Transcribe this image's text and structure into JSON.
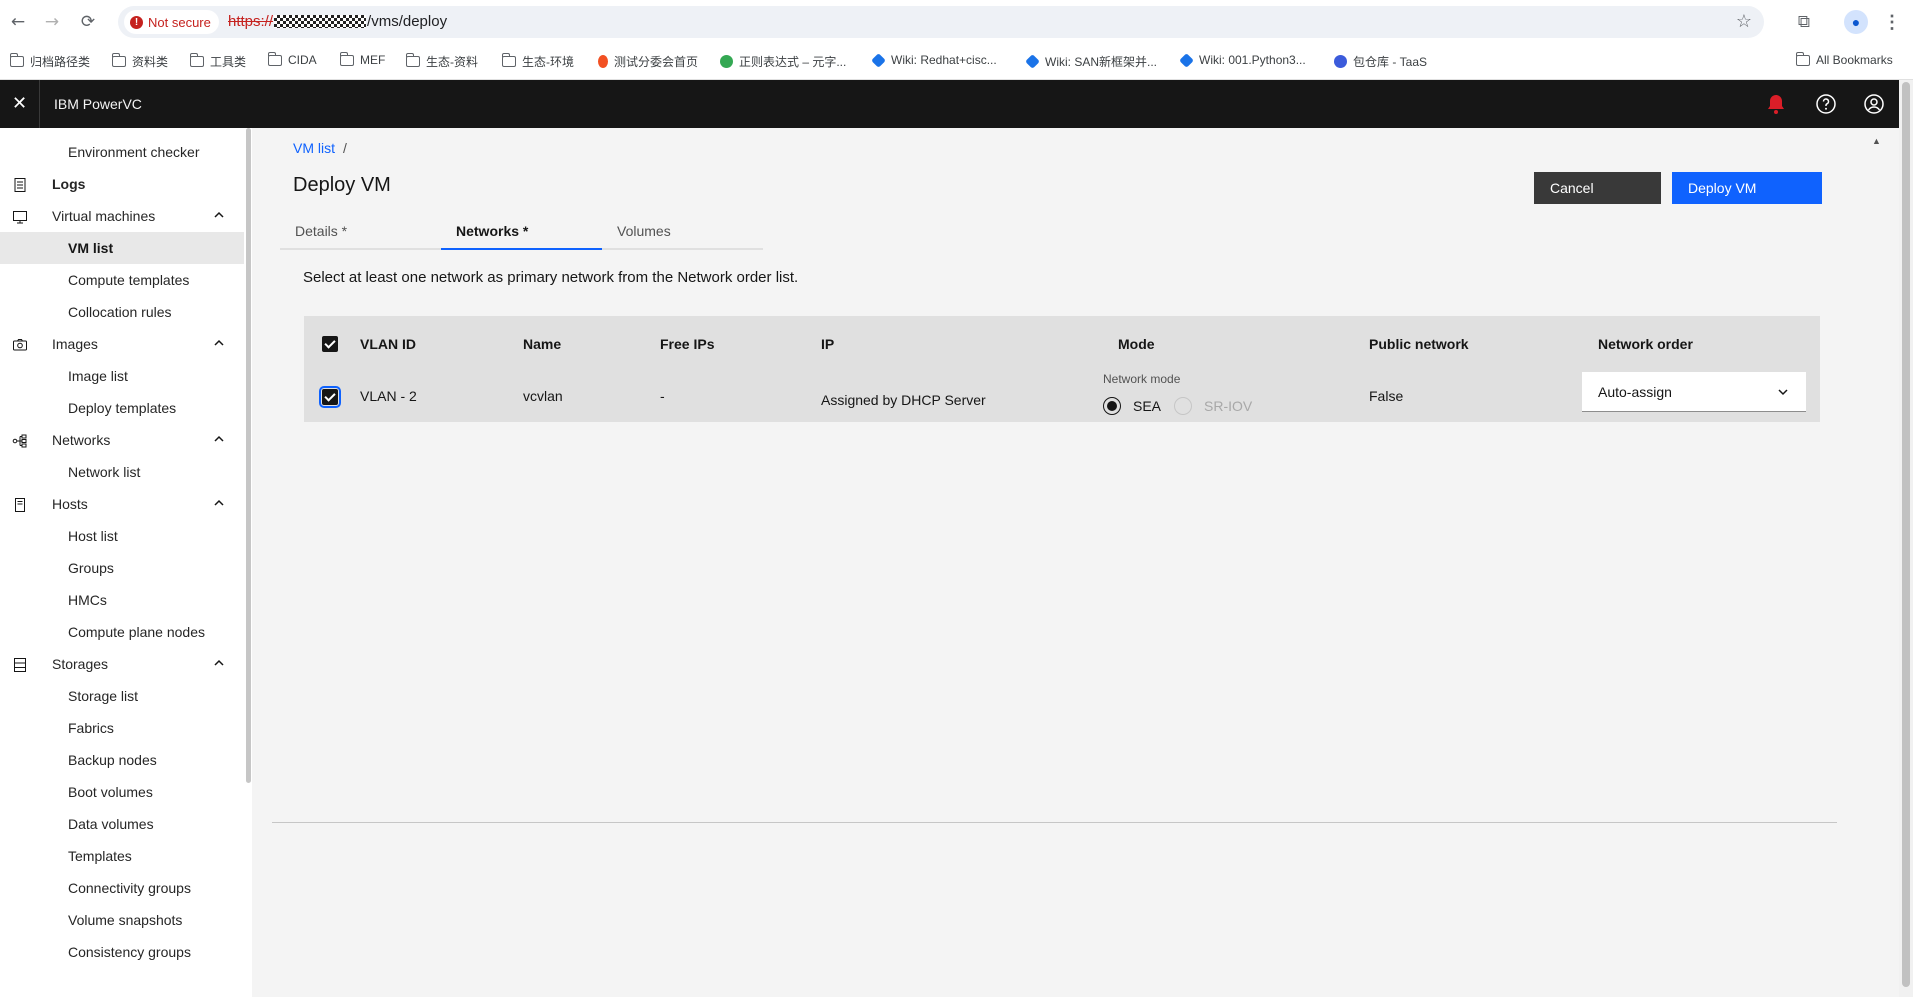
{
  "browser": {
    "security_label": "Not secure",
    "url_scheme": "https://",
    "url_path": "/vms/deploy",
    "bookmarks": [
      {
        "label": "归档路径类",
        "icon": "folder-icon"
      },
      {
        "label": "资料类",
        "icon": "folder-icon"
      },
      {
        "label": "工具类",
        "icon": "folder-icon"
      },
      {
        "label": "CIDA",
        "icon": "folder-icon"
      },
      {
        "label": "MEF",
        "icon": "folder-icon"
      },
      {
        "label": "生态-资料",
        "icon": "folder-icon"
      },
      {
        "label": "生态-环境",
        "icon": "folder-icon"
      },
      {
        "label": "测试分委会首页",
        "icon": "site-icon"
      },
      {
        "label": "正则表达式 – 元字...",
        "icon": "site-icon"
      },
      {
        "label": "Wiki: Redhat+cisc...",
        "icon": "wiki-icon"
      },
      {
        "label": "Wiki: SAN新框架并...",
        "icon": "wiki-icon"
      },
      {
        "label": "Wiki: 001.Python3...",
        "icon": "wiki-icon"
      },
      {
        "label": "包仓库 - TaaS",
        "icon": "site-icon"
      }
    ],
    "all_bookmarks_label": "All Bookmarks"
  },
  "app": {
    "title": "IBM PowerVC"
  },
  "sidenav": {
    "items": [
      {
        "label": "Environment checker",
        "kind": "child"
      },
      {
        "label": "Logs",
        "kind": "top",
        "icon": "logs-icon"
      },
      {
        "label": "Virtual machines",
        "kind": "section",
        "icon": "monitor-icon"
      },
      {
        "label": "VM list",
        "kind": "child",
        "active": true
      },
      {
        "label": "Compute templates",
        "kind": "child"
      },
      {
        "label": "Collocation rules",
        "kind": "child"
      },
      {
        "label": "Images",
        "kind": "section",
        "icon": "camera-icon"
      },
      {
        "label": "Image list",
        "kind": "child"
      },
      {
        "label": "Deploy templates",
        "kind": "child"
      },
      {
        "label": "Networks",
        "kind": "section",
        "icon": "network-icon"
      },
      {
        "label": "Network list",
        "kind": "child"
      },
      {
        "label": "Hosts",
        "kind": "section",
        "icon": "host-icon"
      },
      {
        "label": "Host list",
        "kind": "child"
      },
      {
        "label": "Groups",
        "kind": "child"
      },
      {
        "label": "HMCs",
        "kind": "child"
      },
      {
        "label": "Compute plane nodes",
        "kind": "child"
      },
      {
        "label": "Storages",
        "kind": "section",
        "icon": "storage-icon"
      },
      {
        "label": "Storage list",
        "kind": "child"
      },
      {
        "label": "Fabrics",
        "kind": "child"
      },
      {
        "label": "Backup nodes",
        "kind": "child"
      },
      {
        "label": "Boot volumes",
        "kind": "child"
      },
      {
        "label": "Data volumes",
        "kind": "child"
      },
      {
        "label": "Templates",
        "kind": "child"
      },
      {
        "label": "Connectivity groups",
        "kind": "child"
      },
      {
        "label": "Volume snapshots",
        "kind": "child"
      },
      {
        "label": "Consistency groups",
        "kind": "child"
      }
    ]
  },
  "main": {
    "breadcrumb": {
      "parent": "VM list",
      "separator": "/"
    },
    "title": "Deploy VM",
    "cancel_label": "Cancel",
    "deploy_label": "Deploy VM",
    "tabs": [
      {
        "label": "Details *"
      },
      {
        "label": "Networks *",
        "selected": true
      },
      {
        "label": "Volumes"
      }
    ],
    "instruction": "Select at least one network as primary network from the Network order list.",
    "table": {
      "headers": {
        "vlan_id": "VLAN ID",
        "name": "Name",
        "free_ips": "Free IPs",
        "ip": "IP",
        "mode": "Mode",
        "public_network": "Public network",
        "network_order": "Network order"
      },
      "row": {
        "selected": true,
        "vlan_id": "VLAN - 2",
        "name": "vcvlan",
        "free_ips": "-",
        "ip": "Assigned by DHCP Server",
        "mode_label": "Network mode",
        "mode_sea": "SEA",
        "mode_sriov": "SR-IOV",
        "mode_selected": "SEA",
        "public_network": "False",
        "network_order": "Auto-assign"
      }
    }
  },
  "colors": {
    "primary": "#0f62fe",
    "header_bg": "#161616",
    "alert": "#da1e28"
  }
}
